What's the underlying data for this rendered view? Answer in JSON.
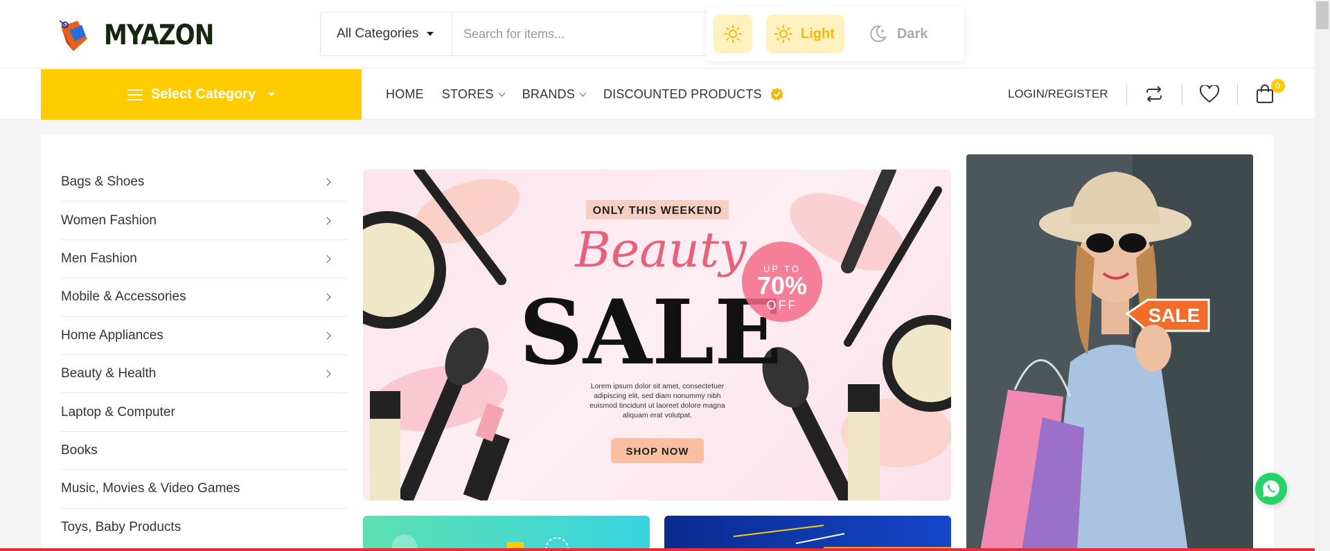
{
  "colors": {
    "accent": "#ffcc00",
    "banner_pink": "#fce4ec",
    "whatsapp": "#25d366"
  },
  "header": {
    "logo_text": "MYAZON",
    "search": {
      "category_label": "All Categories",
      "placeholder": "Search for items..."
    },
    "theme": {
      "light_label": "Light",
      "dark_label": "Dark"
    }
  },
  "nav": {
    "select_category": "Select Category",
    "menu": [
      "HOME",
      "STORES",
      "BRANDS",
      "DISCOUNTED PRODUCTS"
    ],
    "login": "LOGIN/REGISTER",
    "cart_count": "0"
  },
  "categories": [
    {
      "label": "Bags & Shoes"
    },
    {
      "label": "Women Fashion"
    },
    {
      "label": "Men Fashion"
    },
    {
      "label": "Mobile & Accessories"
    },
    {
      "label": "Home Appliances"
    },
    {
      "label": "Beauty & Health"
    },
    {
      "label": "Laptop & Computer"
    },
    {
      "label": "Books"
    },
    {
      "label": "Music, Movies & Video Games"
    },
    {
      "label": "Toys, Baby Products"
    }
  ],
  "banner": {
    "tagline": "ONLY THIS WEEKEND",
    "script_title": "Beauty",
    "big_title": "SALE",
    "upto": "UP TO",
    "discount": "70%",
    "off": "OFF",
    "body_lines": [
      "Lorem ipsum dolor sit amet, consectetuer",
      "adipiscing elit, sed diam nonummy nibh",
      "euismod tincidunt ut laoreet dolore magna",
      "aliquam erat volutpat."
    ],
    "cta": "SHOP NOW"
  },
  "side_banner": {
    "sale_tag": "SALE"
  }
}
